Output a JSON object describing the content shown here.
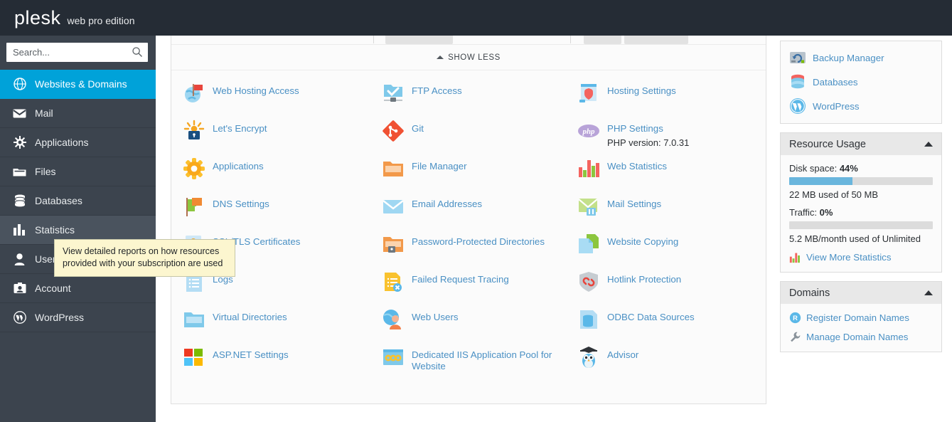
{
  "header": {
    "logo": "plesk",
    "edition": "web pro edition"
  },
  "search": {
    "placeholder": "Search...",
    "value": "",
    "icon": "search-icon"
  },
  "sidebar": {
    "items": [
      {
        "label": "Websites & Domains",
        "icon": "globe-icon",
        "state": "active"
      },
      {
        "label": "Mail",
        "icon": "envelope-icon",
        "state": "normal"
      },
      {
        "label": "Applications",
        "icon": "gear-icon",
        "state": "normal"
      },
      {
        "label": "Files",
        "icon": "folder-icon",
        "state": "normal"
      },
      {
        "label": "Databases",
        "icon": "database-icon",
        "state": "normal"
      },
      {
        "label": "Statistics",
        "icon": "bar-chart-icon",
        "state": "hovered"
      },
      {
        "label": "Users",
        "icon": "user-icon",
        "state": "normal"
      },
      {
        "label": "Account",
        "icon": "id-card-icon",
        "state": "normal"
      },
      {
        "label": "WordPress",
        "icon": "wordpress-icon",
        "state": "normal"
      }
    ]
  },
  "tooltip": {
    "text": "View detailed reports on how resources provided with your subscription are used"
  },
  "main": {
    "show_less": "SHOW LESS",
    "columns": [
      [
        {
          "label": "Web Hosting Access",
          "icon": "globe-flag-icon"
        },
        {
          "label": "Let's Encrypt",
          "icon": "lets-encrypt-icon"
        },
        {
          "label": "Applications",
          "icon": "gear-orange-icon"
        },
        {
          "label": "DNS Settings",
          "icon": "dns-flags-icon"
        },
        {
          "label": "SSL/TLS Certificates",
          "icon": "certificate-icon"
        },
        {
          "label": "Logs",
          "icon": "logs-icon"
        },
        {
          "label": "Virtual Directories",
          "icon": "folder-blue-icon"
        },
        {
          "label": "ASP.NET Settings",
          "icon": "aspnet-icon"
        }
      ],
      [
        {
          "label": "FTP Access",
          "icon": "ftp-icon"
        },
        {
          "label": "Git",
          "icon": "git-icon"
        },
        {
          "label": "File Manager",
          "icon": "folder-orange-icon"
        },
        {
          "label": "Email Addresses",
          "icon": "mail-blue-icon"
        },
        {
          "label": "Password-Protected Directories",
          "icon": "folder-lock-icon"
        },
        {
          "label": "Failed Request Tracing",
          "icon": "failed-request-icon"
        },
        {
          "label": "Web Users",
          "icon": "web-users-icon"
        },
        {
          "label": "Dedicated IIS Application Pool for Website",
          "icon": "iis-pool-icon"
        }
      ],
      [
        {
          "label": "Hosting Settings",
          "icon": "hosting-settings-icon"
        },
        {
          "label": "PHP Settings",
          "icon": "php-icon",
          "sub": "PHP version: 7.0.31"
        },
        {
          "label": "Web Statistics",
          "icon": "web-statistics-icon"
        },
        {
          "label": "Mail Settings",
          "icon": "mail-settings-icon"
        },
        {
          "label": "Website Copying",
          "icon": "website-copying-icon"
        },
        {
          "label": "Hotlink Protection",
          "icon": "hotlink-shield-icon"
        },
        {
          "label": "ODBC Data Sources",
          "icon": "odbc-icon"
        },
        {
          "label": "Advisor",
          "icon": "advisor-owl-icon"
        }
      ]
    ]
  },
  "rail": {
    "shortcuts": [
      {
        "label": "Backup Manager",
        "icon": "backup-icon"
      },
      {
        "label": "Databases",
        "icon": "database-red-icon"
      },
      {
        "label": "WordPress",
        "icon": "wordpress-blue-icon"
      }
    ],
    "resource_usage": {
      "title": "Resource Usage",
      "disk_label": "Disk space:",
      "disk_percent": "44%",
      "disk_fill": 44,
      "disk_note": "22 MB used of 50 MB",
      "traffic_label": "Traffic:",
      "traffic_percent": "0%",
      "traffic_fill": 0,
      "traffic_note": "5.2 MB/month used of Unlimited",
      "more_link": "View More Statistics"
    },
    "domains": {
      "title": "Domains",
      "links": [
        {
          "label": "Register Domain Names",
          "icon": "register-r-icon"
        },
        {
          "label": "Manage Domain Names",
          "icon": "wrench-icon"
        }
      ]
    }
  },
  "colors": {
    "topbar": "#252c35",
    "sidebar": "#3c444e",
    "accent": "#00a2d9",
    "link": "#4a90c4",
    "bar_fill": "#6ab6dd",
    "tooltip_bg": "#fcf6cf"
  }
}
